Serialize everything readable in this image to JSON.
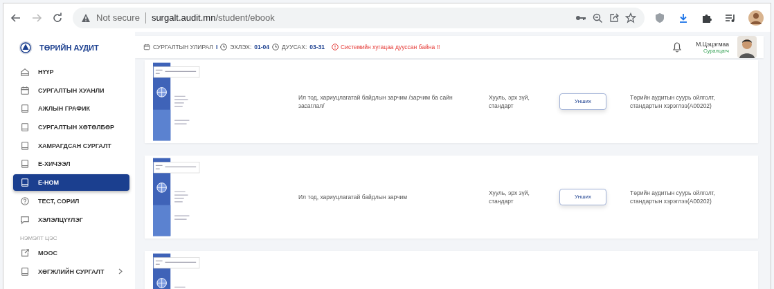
{
  "browser": {
    "security": "Not secure",
    "url_domain": "surgalt.audit.mn",
    "url_path": "/student/ebook"
  },
  "sidebar": {
    "logo": "ТӨРИЙН АУДИТ",
    "items": [
      {
        "label": "НҮҮР",
        "kind": "home",
        "selected": false
      },
      {
        "label": "СУРГАЛТЫН ХУАНЛИ",
        "kind": "calendar",
        "selected": false
      },
      {
        "label": "АЖЛЫН ГРАФИК",
        "kind": "book",
        "selected": false
      },
      {
        "label": "СУРГАЛТЫН ХӨТӨЛБӨР",
        "kind": "book",
        "selected": false
      },
      {
        "label": "ХАМРАГДСАН СУРГАЛТ",
        "kind": "book",
        "selected": false
      },
      {
        "label": "Е-ХИЧЭЭЛ",
        "kind": "book",
        "selected": false
      },
      {
        "label": "Е-НОМ",
        "kind": "book",
        "selected": true
      },
      {
        "label": "ТЕСТ, СОРИЛ",
        "kind": "help",
        "selected": false
      },
      {
        "label": "ХЭЛЭЛЦҮҮЛЭГ",
        "kind": "chat",
        "selected": false
      }
    ],
    "section_title": "НЭМЭЛТ ЦЭС",
    "extra_items": [
      {
        "label": "MOOC",
        "kind": "external",
        "selected": false,
        "expandable": false
      },
      {
        "label": "ХӨГЖЛИЙН СУРГАЛТ",
        "kind": "book",
        "selected": false,
        "expandable": true
      }
    ]
  },
  "header": {
    "term_label": "СУРГАЛТЫН УЛИРАЛ",
    "term": "I",
    "start_label": "ЭХЛЭХ:",
    "start": "01-04",
    "end_label": "ДУУСАХ:",
    "end": "03-31",
    "alert": "Системийн хугацаа дууссан байна !!"
  },
  "user": {
    "name": "М.Цэцэгмаа",
    "role": "Суралцагч"
  },
  "books": [
    {
      "kind": "full",
      "title": "Ил тод, хариуцлагатай байдлын зарчим /зарчим ба сайн засаглал/",
      "category": "Хууль, эрх зүй, стандарт",
      "button": "Унших",
      "course": "Төрийн аудитын суурь ойлголт, стандартын хэрэглээ(А00202)"
    },
    {
      "kind": "full",
      "title": "Ил тод, хариуцлагатай байдлын зарчим",
      "category": "Хууль, эрх зүй, стандарт",
      "button": "Унших",
      "course": "Төрийн аудитын суурь ойлголт, стандартын хэрэглээ(А00202)"
    },
    {
      "kind": "cover_only"
    }
  ]
}
